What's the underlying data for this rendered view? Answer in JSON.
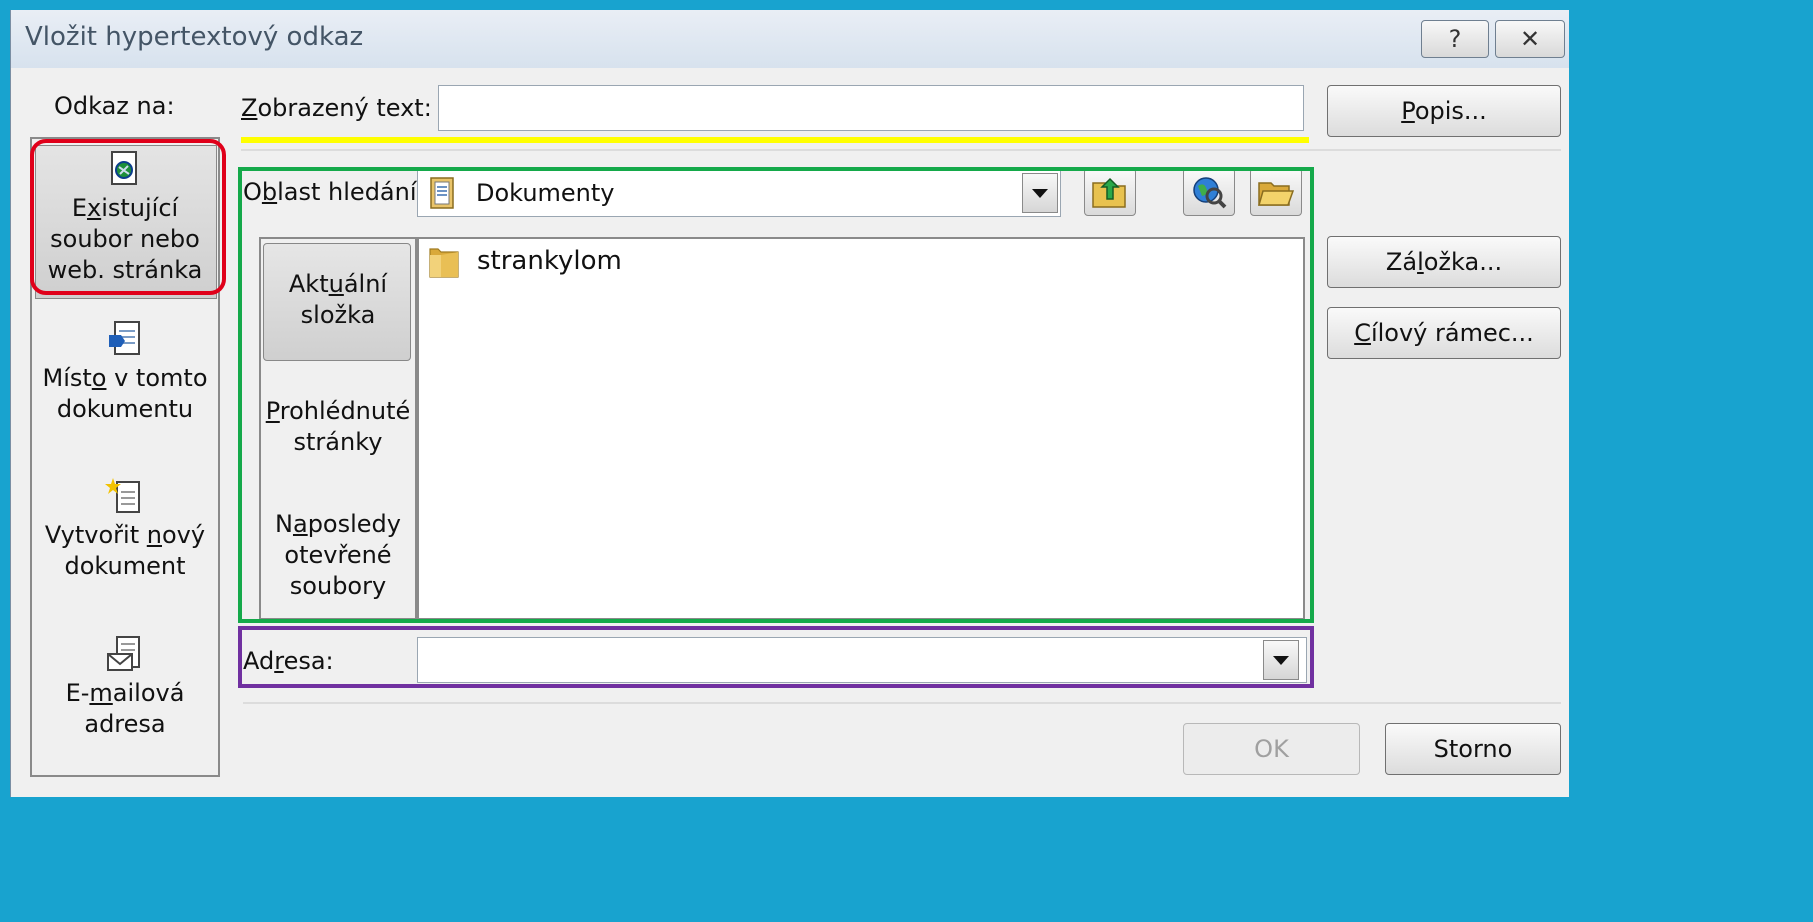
{
  "window": {
    "title": "Vložit hypertextový odkaz",
    "help_glyph": "?",
    "close_glyph": "✕"
  },
  "link_to": {
    "label": "Odkaz na:",
    "items": [
      {
        "pre": "E",
        "ul": "x",
        "post": "istující",
        "line2": "soubor nebo",
        "line3": "web. stránka",
        "icon": "existing-file-icon",
        "selected": true
      },
      {
        "pre": "Míst",
        "ul": "o",
        "post": " v tomto",
        "line2": "dokumentu",
        "line3": "",
        "icon": "place-in-document-icon",
        "selected": false
      },
      {
        "pre": "Vytvořit ",
        "ul": "n",
        "post": "ový",
        "line2": "dokument",
        "line3": "",
        "icon": "new-document-icon",
        "selected": false
      },
      {
        "pre": "E-",
        "ul": "m",
        "post": "ailová",
        "line2": "adresa",
        "line3": "",
        "icon": "email-address-icon",
        "selected": false
      }
    ]
  },
  "display_text": {
    "pre": "",
    "ul": "Z",
    "post": "obrazený text:",
    "value": ""
  },
  "popis_button": {
    "pre": "",
    "ul": "P",
    "post": "opis..."
  },
  "look_in": {
    "pre": "O",
    "ul": "b",
    "post": "last hledání:",
    "value": "Dokumenty"
  },
  "nav": {
    "items": [
      {
        "pre": "Akt",
        "ul": "u",
        "post": "ální",
        "line2": "složka",
        "line3": ""
      },
      {
        "pre": "",
        "ul": "P",
        "post": "rohlédnuté",
        "line2": "stránky",
        "line3": ""
      },
      {
        "pre": "N",
        "ul": "a",
        "post": "posledy",
        "line2": "otevřené",
        "line3": "soubory"
      }
    ]
  },
  "files": [
    {
      "name": "strankylom",
      "icon": "folder-icon"
    }
  ],
  "bookmark_button": {
    "pre": "Zá",
    "ul": "l",
    "post": "ožka..."
  },
  "target_frame_button": {
    "pre": "",
    "ul": "C",
    "post": "ílový rámec..."
  },
  "address": {
    "pre": "Ad",
    "ul": "r",
    "post": "esa:",
    "value": ""
  },
  "ok_label": "OK",
  "cancel_label": "Storno",
  "colors": {
    "annotation_red": "#e0001a",
    "annotation_yellow": "#ffff00",
    "annotation_green": "#14a94a",
    "annotation_purple": "#7030a0"
  }
}
